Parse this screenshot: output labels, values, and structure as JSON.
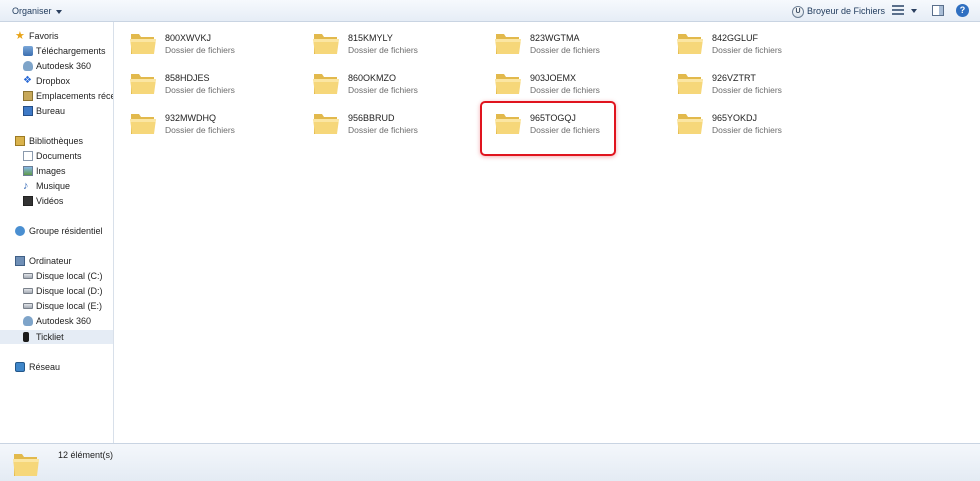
{
  "toolbar": {
    "organiser_label": "Organiser",
    "browser_label": "Broyeur de Fichiers",
    "help_label": "?"
  },
  "sidebar": {
    "favorites": {
      "label": "Favoris",
      "items": [
        {
          "label": "Téléchargements",
          "icon": "download-icon"
        },
        {
          "label": "Autodesk 360",
          "icon": "cloud-icon"
        },
        {
          "label": "Dropbox",
          "icon": "dropbox-icon"
        },
        {
          "label": "Emplacements récen",
          "icon": "recent-places-icon"
        },
        {
          "label": "Bureau",
          "icon": "desktop-icon"
        }
      ]
    },
    "libraries": {
      "label": "Bibliothèques",
      "items": [
        {
          "label": "Documents",
          "icon": "documents-icon"
        },
        {
          "label": "Images",
          "icon": "images-icon"
        },
        {
          "label": "Musique",
          "icon": "music-icon"
        },
        {
          "label": "Vidéos",
          "icon": "videos-icon"
        }
      ]
    },
    "homegroup": {
      "label": "Groupe résidentiel"
    },
    "computer": {
      "label": "Ordinateur",
      "items": [
        {
          "label": "Disque local (C:)",
          "icon": "drive-icon"
        },
        {
          "label": "Disque local (D:)",
          "icon": "drive-icon"
        },
        {
          "label": "Disque local (E:)",
          "icon": "drive-icon"
        },
        {
          "label": "Autodesk 360",
          "icon": "cloud-icon"
        },
        {
          "label": "Tickliet",
          "icon": "phone-icon"
        }
      ]
    },
    "network": {
      "label": "Réseau"
    }
  },
  "folders": [
    {
      "name": "800XWVKJ",
      "type": "Dossier de fichiers"
    },
    {
      "name": "815KMYLY",
      "type": "Dossier de fichiers"
    },
    {
      "name": "823WGTMA",
      "type": "Dossier de fichiers"
    },
    {
      "name": "842GGLUF",
      "type": "Dossier de fichiers"
    },
    {
      "name": "858HDJES",
      "type": "Dossier de fichiers"
    },
    {
      "name": "860OKMZO",
      "type": "Dossier de fichiers"
    },
    {
      "name": "903JOEMX",
      "type": "Dossier de fichiers"
    },
    {
      "name": "926VZTRT",
      "type": "Dossier de fichiers"
    },
    {
      "name": "932MWDHQ",
      "type": "Dossier de fichiers"
    },
    {
      "name": "956BBRUD",
      "type": "Dossier de fichiers"
    },
    {
      "name": "965TOGQJ",
      "type": "Dossier de fichiers"
    },
    {
      "name": "965YOKDJ",
      "type": "Dossier de fichiers"
    }
  ],
  "status": {
    "count_label": "12 élément(s)"
  },
  "colors": {
    "highlight": "#e0141e",
    "folder": "#f2cf6b"
  }
}
